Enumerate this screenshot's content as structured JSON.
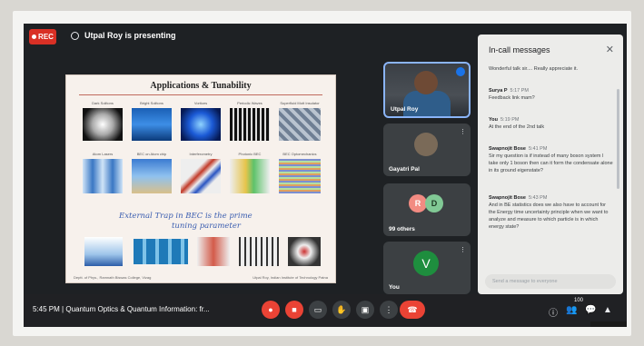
{
  "recording": {
    "label": "REC"
  },
  "presenter": {
    "text": "Utpal Roy is presenting"
  },
  "slide": {
    "title": "Applications & Tunability",
    "panels": [
      {
        "label": "Dark Solitons"
      },
      {
        "label": "Bright Solitons"
      },
      {
        "label": "Vortices"
      },
      {
        "label": "Periodic Waves"
      },
      {
        "label": "Superfluid Mott Insulator"
      },
      {
        "label": "Atom Lasers"
      },
      {
        "label": "BEC on Atom chip"
      },
      {
        "label": "Interferometry"
      },
      {
        "label": "Photonic BEC"
      },
      {
        "label": "BEC Optomechanics"
      }
    ],
    "handwriting_line1": "External Trap in BEC is the prime",
    "handwriting_line2": "tuning parameter",
    "footer_left": "Deptt. of Phys., Ramnath Biswas College, Vizag",
    "footer_right": "Utpal Roy, Indian Institute of Technology Patna"
  },
  "tiles": [
    {
      "name": "Utpal Roy"
    },
    {
      "name": "Gayatri Pal"
    },
    {
      "name": "99 others",
      "initials": [
        "R",
        "D"
      ]
    },
    {
      "name": "You",
      "initial": "V"
    }
  ],
  "chat": {
    "title": "In-call messages",
    "close_icon": "close-icon",
    "messages": [
      {
        "sender": "",
        "time": "",
        "text": "Wonderful talk sir.... Really appreciate it."
      },
      {
        "sender": "Surya P",
        "time": "5:17 PM",
        "text": "Feedback link mam?"
      },
      {
        "sender": "You",
        "time": "5:19 PM",
        "text": "At the end of the 2nd talk"
      },
      {
        "sender": "Swapnojit Bose",
        "time": "5:41 PM",
        "text": "Sir my question is if instead of many boson system I take only 1 boson then can it form the condensate alone in its ground eigenstate?"
      },
      {
        "sender": "Swapnojit Bose",
        "time": "5:43 PM",
        "text": "And in BE statistics does we also have to account for the Energy time uncertainty principle when we want to analyze and measure to which particle is in which energy state?"
      }
    ],
    "input_placeholder": "Send a message to everyone"
  },
  "bottom": {
    "clock": "5:45 PM",
    "meeting_title": "Quantum Optics & Quantum Information: fr...",
    "people_badge": "100"
  },
  "colors": {
    "accent": "#8ab4f8",
    "danger": "#ea4335",
    "background": "#202124"
  }
}
